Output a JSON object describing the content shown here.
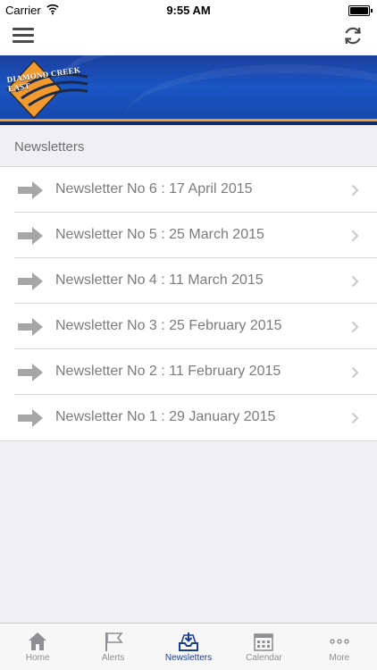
{
  "status_bar": {
    "carrier": "Carrier",
    "time": "9:55 AM"
  },
  "banner": {
    "logo_text": "DIAMOND CREEK EAST"
  },
  "section": {
    "title": "Newsletters"
  },
  "newsletters": [
    {
      "label": "Newsletter No 6 : 17 April 2015"
    },
    {
      "label": "Newsletter No 5 : 25 March 2015"
    },
    {
      "label": "Newsletter No 4 : 11 March 2015"
    },
    {
      "label": "Newsletter No 3 : 25 February 2015"
    },
    {
      "label": "Newsletter No 2 : 11 February 2015"
    },
    {
      "label": "Newsletter No 1 : 29 January 2015"
    }
  ],
  "tabs": [
    {
      "label": "Home",
      "icon": "home-icon",
      "active": false
    },
    {
      "label": "Alerts",
      "icon": "flag-icon",
      "active": false
    },
    {
      "label": "Newsletters",
      "icon": "inbox-icon",
      "active": true
    },
    {
      "label": "Calendar",
      "icon": "calendar-icon",
      "active": false
    },
    {
      "label": "More",
      "icon": "more-icon",
      "active": false
    }
  ],
  "colors": {
    "accent": "#1c3c8c",
    "banner_blue": "#1a56c4",
    "banner_orange": "#f29a2e",
    "inactive_icon": "#8e8e93"
  }
}
